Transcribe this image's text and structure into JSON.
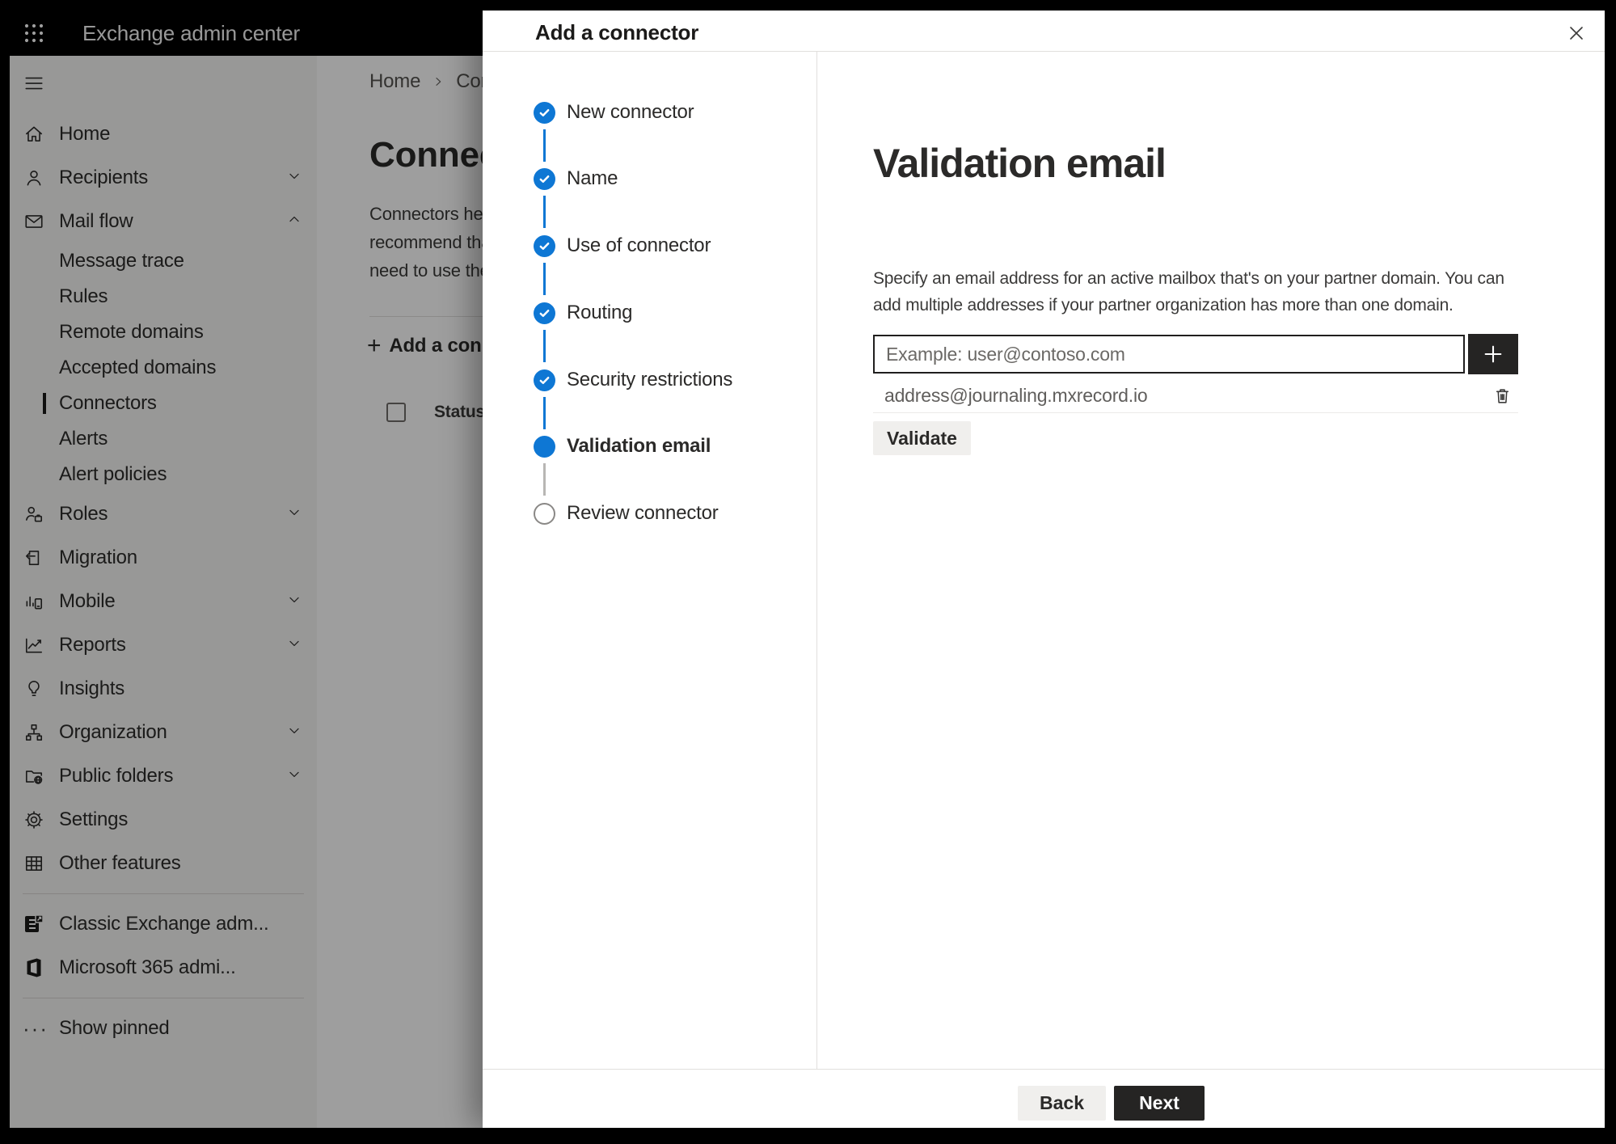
{
  "topbar": {
    "title": "Exchange admin center"
  },
  "sidebar": {
    "items_top": [
      {
        "label": "Home",
        "icon": "home-icon",
        "chevron": null
      },
      {
        "label": "Recipients",
        "icon": "person-icon",
        "chevron": "down"
      },
      {
        "label": "Mail flow",
        "icon": "mail-icon",
        "chevron": "up",
        "expanded": true
      }
    ],
    "mailflow_children": [
      "Message trace",
      "Rules",
      "Remote domains",
      "Accepted domains",
      "Connectors",
      "Alerts",
      "Alert policies"
    ],
    "selected_child": "Connectors",
    "items_bottom": [
      {
        "label": "Roles",
        "icon": "person-briefcase-icon",
        "chevron": "down"
      },
      {
        "label": "Migration",
        "icon": "page-arrow-icon",
        "chevron": null
      },
      {
        "label": "Mobile",
        "icon": "chart-phone-icon",
        "chevron": "down"
      },
      {
        "label": "Reports",
        "icon": "trend-chart-icon",
        "chevron": "down"
      },
      {
        "label": "Insights",
        "icon": "lightbulb-icon",
        "chevron": null
      },
      {
        "label": "Organization",
        "icon": "org-tree-icon",
        "chevron": "down"
      },
      {
        "label": "Public folders",
        "icon": "folder-globe-icon",
        "chevron": "down"
      },
      {
        "label": "Settings",
        "icon": "gear-icon",
        "chevron": null
      },
      {
        "label": "Other features",
        "icon": "grid-table-icon",
        "chevron": null
      }
    ],
    "footer_items": [
      {
        "label": "Classic Exchange adm...",
        "icon": "exchange-logo-icon"
      },
      {
        "label": "Microsoft 365 admi...",
        "icon": "microsoft-365-logo-icon"
      }
    ],
    "show_pinned": "Show pinned"
  },
  "page": {
    "breadcrumb": [
      "Home",
      "Conne"
    ],
    "title": "Connec",
    "paragraph_lines": [
      "Connectors help",
      "recommend tha",
      "need to use ther"
    ],
    "add_button": "Add a conn",
    "add_plus": "+",
    "table": {
      "status_column": "Status"
    }
  },
  "modal": {
    "title": "Add a connector",
    "steps": [
      {
        "label": "New connector",
        "state": "completed"
      },
      {
        "label": "Name",
        "state": "completed"
      },
      {
        "label": "Use of connector",
        "state": "completed"
      },
      {
        "label": "Routing",
        "state": "completed"
      },
      {
        "label": "Security restrictions",
        "state": "completed"
      },
      {
        "label": "Validation email",
        "state": "current"
      },
      {
        "label": "Review connector",
        "state": "upcoming"
      }
    ],
    "content": {
      "heading": "Validation email",
      "description": "Specify an email address for an active mailbox that's on your partner domain. You can add multiple addresses if your partner organization has more than one domain.",
      "input_placeholder": "Example: user@contoso.com",
      "input_value": "",
      "addresses": [
        "address@journaling.mxrecord.io"
      ],
      "validate_button": "Validate"
    },
    "footer": {
      "back": "Back",
      "next": "Next"
    }
  },
  "colors": {
    "accent_blue": "#0e77d4",
    "dark_button": "#252423",
    "topbar": "#000000",
    "sidebar_bg": "#f6f5f4",
    "overlay": "rgba(0,0,0,0.38)",
    "step_upcoming_border": "#8a8886"
  }
}
